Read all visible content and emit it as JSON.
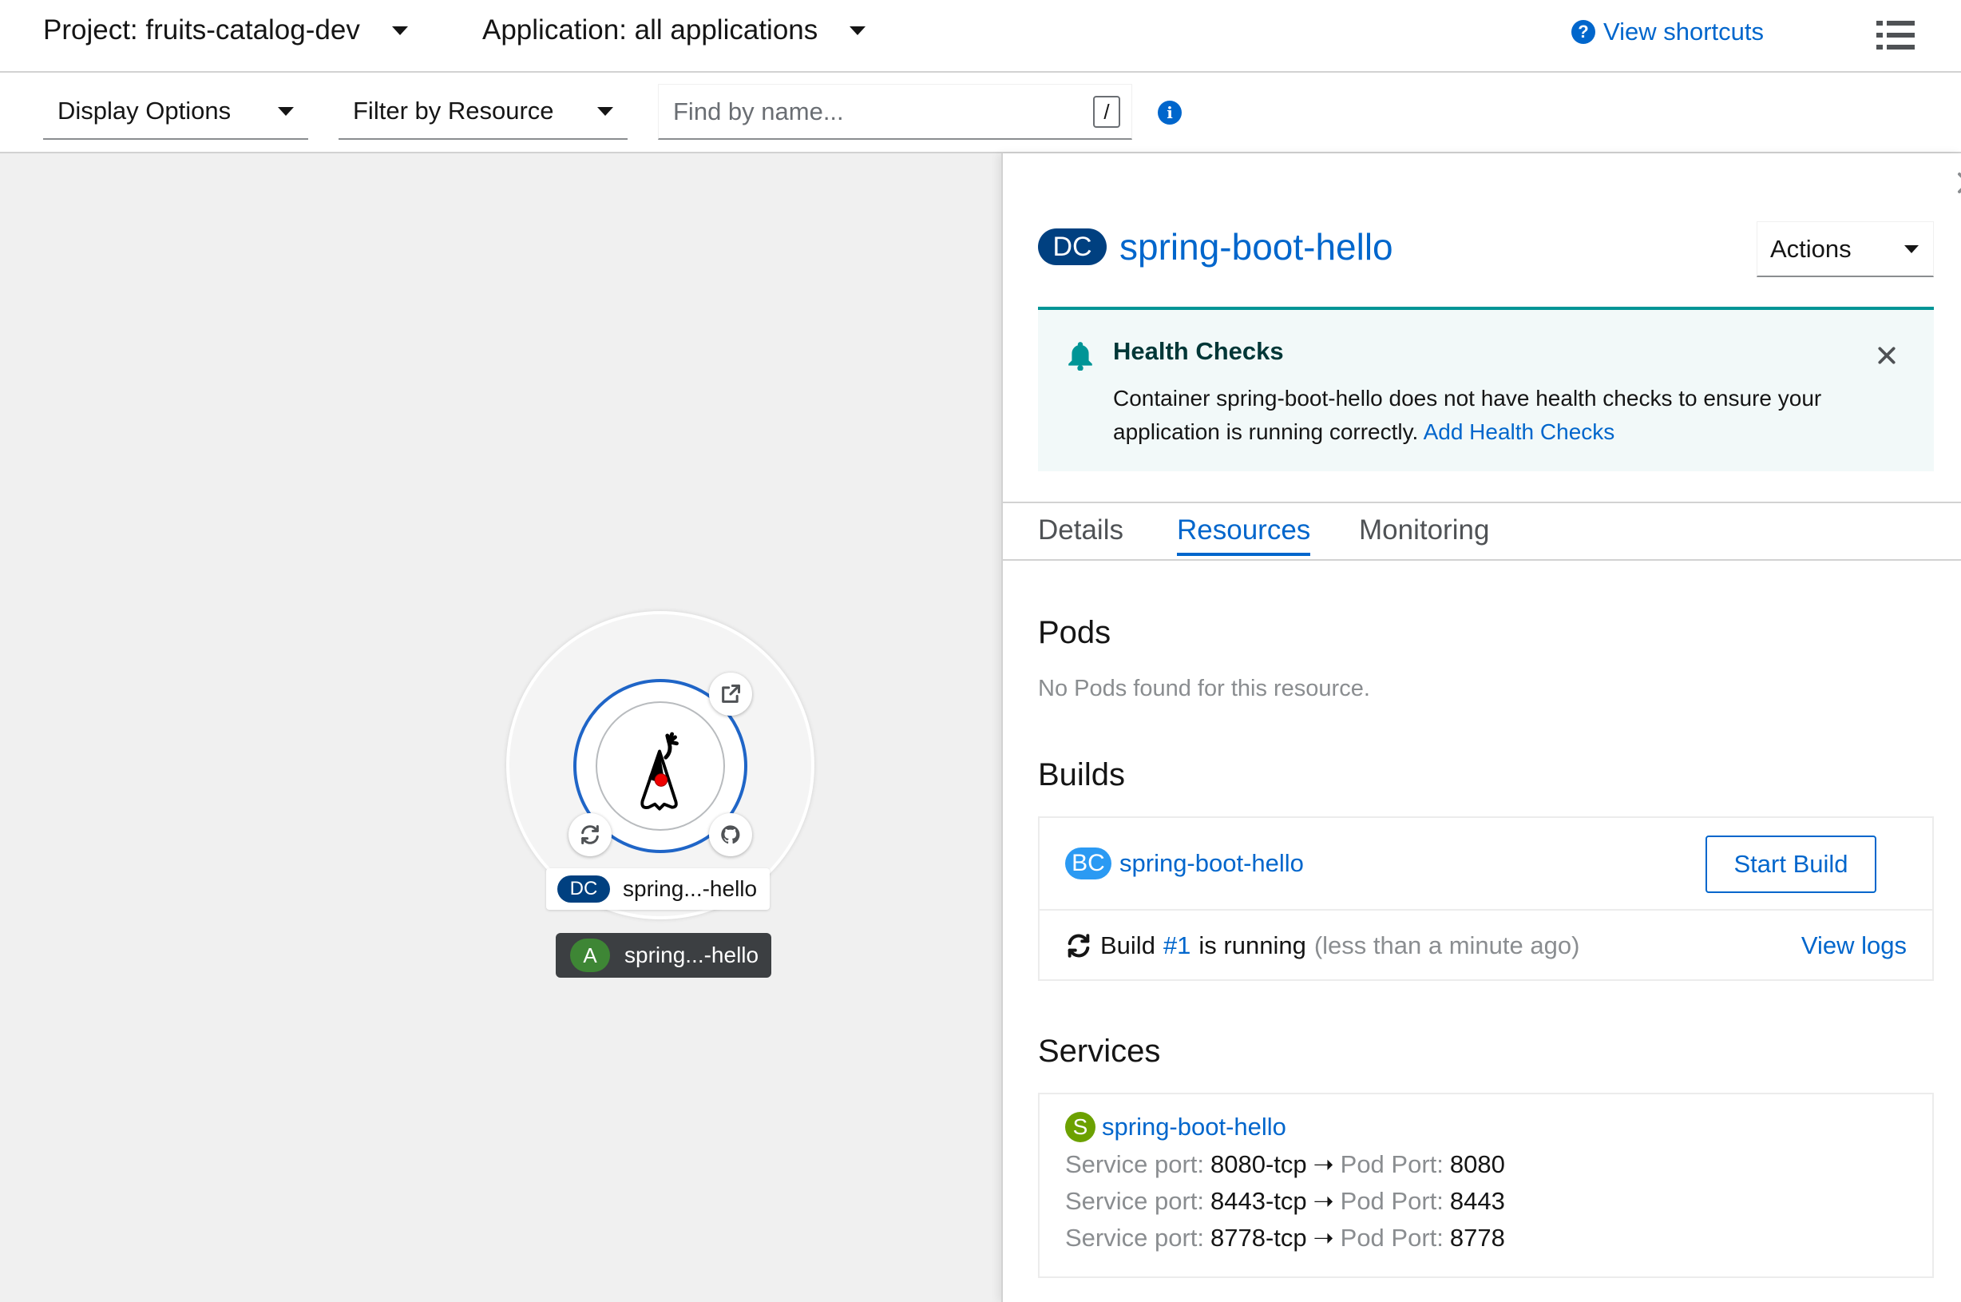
{
  "topbar": {
    "project_label": "Project: fruits-catalog-dev",
    "application_label": "Application: all applications",
    "shortcuts_label": "View shortcuts"
  },
  "toolbar": {
    "display_options": "Display Options",
    "filter_by_resource": "Filter by Resource",
    "search_placeholder": "Find by name...",
    "search_hotkey": "/"
  },
  "topology": {
    "node_badge": "DC",
    "node_label": "spring...-hello",
    "app_badge": "A",
    "app_label": "spring...-hello"
  },
  "panel": {
    "resource_badge": "DC",
    "resource_name": "spring-boot-hello",
    "actions_label": "Actions",
    "alert": {
      "title": "Health Checks",
      "body": "Container spring-boot-hello does not have health checks to ensure your application is running correctly.",
      "link": "Add Health Checks"
    },
    "tabs": [
      "Details",
      "Resources",
      "Monitoring"
    ],
    "active_tab": "Resources",
    "pods": {
      "title": "Pods",
      "empty": "No Pods found for this resource."
    },
    "builds": {
      "title": "Builds",
      "badge": "BC",
      "name": "spring-boot-hello",
      "start_build": "Start Build",
      "status_prefix": "Build",
      "build_number": "#1",
      "status_suffix": "is running",
      "time": "(less than a minute ago)",
      "view_logs": "View logs"
    },
    "services": {
      "title": "Services",
      "badge": "S",
      "name": "spring-boot-hello",
      "service_port_label": "Service port:",
      "pod_port_label": "Pod Port:",
      "ports": [
        {
          "service_port": "8080-tcp",
          "pod_port": "8080"
        },
        {
          "service_port": "8443-tcp",
          "pod_port": "8443"
        },
        {
          "service_port": "8778-tcp",
          "pod_port": "8778"
        }
      ]
    }
  },
  "colors": {
    "link_blue": "#0066cc",
    "dc_badge": "#004080",
    "bc_badge": "#2b9af3",
    "app_badge": "#3e8635",
    "service_badge": "#6ca100",
    "alert_teal": "#009596"
  }
}
